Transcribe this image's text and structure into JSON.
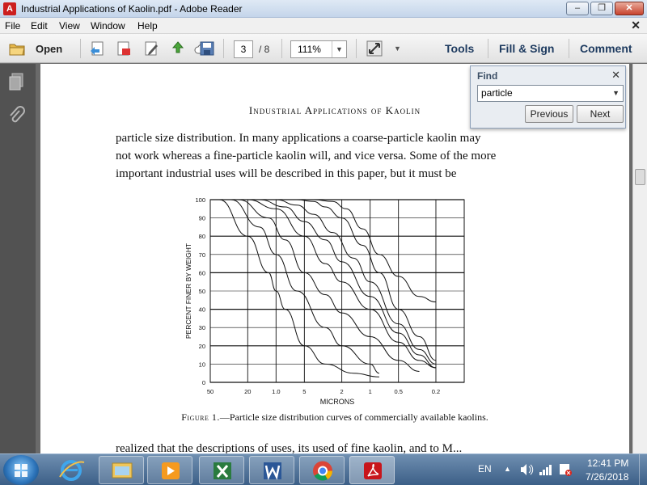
{
  "window": {
    "title": "Industrial Applications of Kaolin.pdf - Adobe Reader",
    "app_icon_glyph": "A",
    "minimize_glyph": "–",
    "maximize_glyph": "❐",
    "close_glyph": "✕"
  },
  "menu": {
    "items": [
      "File",
      "Edit",
      "View",
      "Window",
      "Help"
    ],
    "doc_close_glyph": "✕"
  },
  "toolbar": {
    "open_label": "Open",
    "current_page": "3",
    "total_pages": "/ 8",
    "zoom": "111%",
    "dropdown_glyph": "▼",
    "tools_label": "Tools",
    "fill_sign_label": "Fill & Sign",
    "comment_label": "Comment"
  },
  "find": {
    "title": "Find",
    "close_glyph": "✕",
    "query": "particle",
    "dropdown_glyph": "▼",
    "previous_label": "Previous",
    "next_label": "Next"
  },
  "document": {
    "running_head": "Industrial Applications of Kaolin",
    "paragraph_lines": [
      "particle size distribution. In many applications a coarse-particle kaolin may",
      "not work whereas a fine-particle kaolin will, and vice versa. Some of the more",
      "important industrial uses will be described in this paper, but it must be"
    ],
    "caption_label": "Figure 1.",
    "caption_text": "—Particle size distribution curves of commercially available kaolins.",
    "bottom_line": "realized that the descriptions of uses, its used of fine kaolin, and to M..."
  },
  "chart_data": {
    "type": "line",
    "xlabel": "MICRONS",
    "ylabel": "PERCENT FINER BY WEIGHT",
    "x_scale": "log",
    "x_reversed": true,
    "xlim": [
      50,
      0.1
    ],
    "ylim": [
      0,
      100
    ],
    "x_ticks": [
      50,
      20,
      10,
      5,
      2,
      1,
      0.5,
      0.2
    ],
    "x_tick_labels": [
      "50",
      "20",
      "1.0",
      "5",
      "2",
      "1",
      "0.5",
      "0.2"
    ],
    "y_ticks": [
      0,
      10,
      20,
      30,
      40,
      50,
      60,
      70,
      80,
      90,
      100
    ],
    "y_tick_labels": [
      "0",
      "10",
      "20",
      "30",
      "40",
      "50",
      "60",
      "70",
      "80",
      "90",
      "100"
    ],
    "grid": true,
    "series": [
      {
        "x": [
          40,
          20,
          12,
          10,
          8,
          5,
          3,
          1.5,
          0.8
        ],
        "y": [
          100,
          80,
          60,
          50,
          40,
          20,
          10,
          5,
          3
        ]
      },
      {
        "x": [
          30,
          15,
          10,
          6,
          3,
          2,
          1,
          0.8
        ],
        "y": [
          100,
          85,
          70,
          50,
          30,
          20,
          10,
          5
        ]
      },
      {
        "x": [
          25,
          12,
          8,
          5,
          3,
          2,
          1,
          0.5,
          0.3
        ],
        "y": [
          100,
          90,
          78,
          60,
          48,
          38,
          25,
          12,
          6
        ]
      },
      {
        "x": [
          20,
          10,
          5,
          3,
          2,
          1,
          0.5,
          0.3,
          0.2
        ],
        "y": [
          100,
          95,
          80,
          65,
          55,
          40,
          22,
          12,
          8
        ]
      },
      {
        "x": [
          15,
          8,
          5,
          3,
          2,
          1,
          0.5,
          0.3,
          0.2
        ],
        "y": [
          100,
          96,
          88,
          78,
          66,
          47,
          27,
          15,
          8
        ]
      },
      {
        "x": [
          10,
          6,
          4,
          2.5,
          1.5,
          1,
          0.5,
          0.3,
          0.2
        ],
        "y": [
          100,
          97,
          92,
          82,
          68,
          55,
          32,
          18,
          10
        ]
      },
      {
        "x": [
          6,
          4,
          3,
          2,
          1.2,
          0.8,
          0.5,
          0.3,
          0.2
        ],
        "y": [
          100,
          99,
          96,
          90,
          75,
          60,
          40,
          25,
          12
        ]
      },
      {
        "x": [
          4,
          2.5,
          1.8,
          1.2,
          0.8,
          0.5,
          0.3,
          0.2
        ],
        "y": [
          100,
          99,
          95,
          84,
          70,
          58,
          47,
          44
        ]
      }
    ]
  },
  "taskbar": {
    "language": "EN",
    "time": "12:41 PM",
    "date": "7/26/2018",
    "tray_arrow": "▲"
  }
}
